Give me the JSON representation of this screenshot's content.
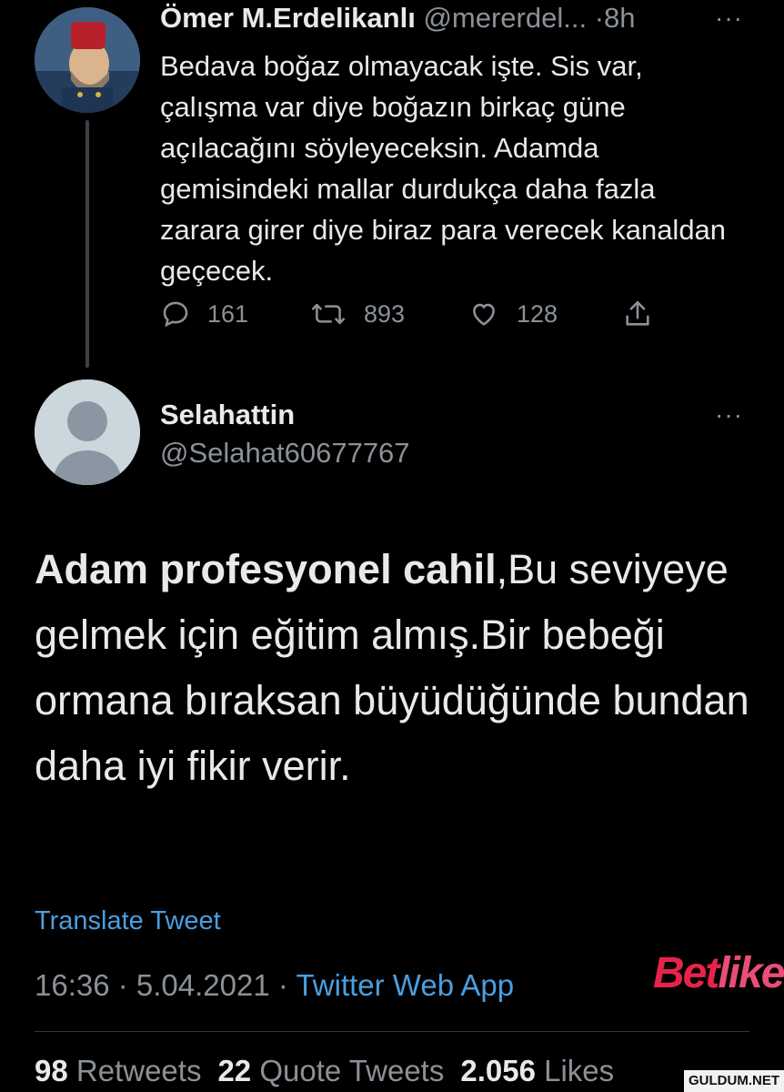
{
  "parent_tweet": {
    "name": "Ömer M.Erdelikanlı",
    "handle": "@mererdel...",
    "separator": "·",
    "time": "8h",
    "more": "···",
    "body": "Bedava boğaz olmayacak işte. Sis var, çalışma var diye boğazın birkaç güne açılacağını söyleyeceksin. Adamda gemisindeki mallar durdukça daha fazla zarara girer diye biraz para verecek kanaldan geçecek.",
    "replies": "161",
    "retweets": "893",
    "likes": "128"
  },
  "reply_tweet": {
    "name": "Selahattin",
    "handle": "@Selahat60677767",
    "more": "···",
    "body_bold": "Adam profesyonel cahil",
    "body_rest": ",Bu seviyeye gelmek için eğitim almış.Bir bebeği ormana bıraksan büyüdüğünde bundan daha iyi fikir verir.",
    "translate": "Translate Tweet",
    "timestamp": "16:36 · 5.04.2021 · ",
    "source": "Twitter Web App",
    "stats": {
      "retweets_count": "98",
      "retweets_label": "Retweets",
      "quotes_count": "22",
      "quotes_label": "Quote Tweets",
      "likes_count": "2.056",
      "likes_label": "Likes"
    }
  },
  "watermarks": {
    "betlike_part1": "Bet",
    "betlike_part2": "like",
    "guldum": "GULDUM.NET"
  },
  "colors": {
    "background": "#000000",
    "link": "#4a9ee0",
    "muted": "#8b9197",
    "betlike_red": "#e8234a"
  },
  "icons": [
    "reply-icon",
    "retweet-icon",
    "like-icon",
    "share-icon",
    "more-icon",
    "default-avatar-icon"
  ]
}
